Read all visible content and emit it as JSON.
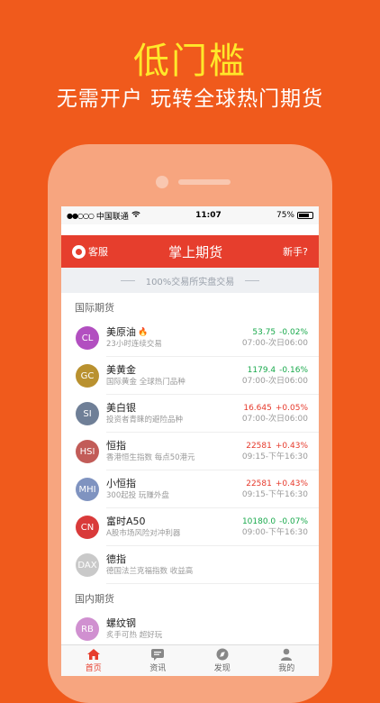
{
  "promo": {
    "headline": "低门槛",
    "subheadline": "无需开户  玩转全球热门期货"
  },
  "status_bar": {
    "signal": "●●○○○",
    "carrier": "中国联通",
    "wifi": "wifi-icon",
    "time": "11:07",
    "battery_text": "75%",
    "battery_level": 0.75
  },
  "nav": {
    "service_label": "客服",
    "title": "掌上期货",
    "newbie_label": "新手?"
  },
  "banner": {
    "text": "100%交易所实盘交易"
  },
  "sections": [
    {
      "title": "国际期货",
      "items": [
        {
          "code": "CL",
          "color": "#b24fc0",
          "name": "美原油",
          "hot": true,
          "desc": "23小时连续交易",
          "price": "53.75",
          "change": "-0.02%",
          "trend": "down",
          "hours": "07:00-次日06:00"
        },
        {
          "code": "GC",
          "color": "#b9912f",
          "name": "美黄金",
          "hot": false,
          "desc": "国际黄金 全球热门品种",
          "price": "1179.4",
          "change": "-0.16%",
          "trend": "down",
          "hours": "07:00-次日06:00"
        },
        {
          "code": "SI",
          "color": "#6f7f97",
          "name": "美白银",
          "hot": false,
          "desc": "投资者青睐的避险品种",
          "price": "16.645",
          "change": "+0.05%",
          "trend": "up",
          "hours": "07:00-次日06:00"
        },
        {
          "code": "HSI",
          "color": "#c25c58",
          "name": "恒指",
          "hot": false,
          "desc": "香港恒生指数 每点50港元",
          "price": "22581",
          "change": "+0.43%",
          "trend": "up",
          "hours": "09:15-下午16:30"
        },
        {
          "code": "MHI",
          "color": "#7f93c0",
          "name": "小恒指",
          "hot": false,
          "desc": "300起投 玩赚外盘",
          "price": "22581",
          "change": "+0.43%",
          "trend": "up",
          "hours": "09:15-下午16:30"
        },
        {
          "code": "CN",
          "color": "#d93a3a",
          "name": "富时A50",
          "hot": false,
          "desc": "A股市场风险对冲利器",
          "price": "10180.0",
          "change": "-0.07%",
          "trend": "down",
          "hours": "09:00-下午16:30"
        },
        {
          "code": "DAX",
          "color": "#c9c9c9",
          "name": "德指",
          "hot": false,
          "desc": "德国法兰克福指数 收益高",
          "price": "",
          "change": "",
          "trend": "",
          "hours": ""
        }
      ]
    },
    {
      "title": "国内期货",
      "items": [
        {
          "code": "RB",
          "color": "#d090d0",
          "name": "螺纹钢",
          "hot": false,
          "desc": "炙手可热 超好玩",
          "price": "",
          "change": "",
          "trend": "",
          "hours": ""
        }
      ]
    }
  ],
  "tabs": [
    {
      "label": "首页",
      "icon": "home-icon",
      "active": true
    },
    {
      "label": "资讯",
      "icon": "news-icon",
      "active": false
    },
    {
      "label": "发现",
      "icon": "compass-icon",
      "active": false
    },
    {
      "label": "我的",
      "icon": "user-icon",
      "active": false
    }
  ]
}
